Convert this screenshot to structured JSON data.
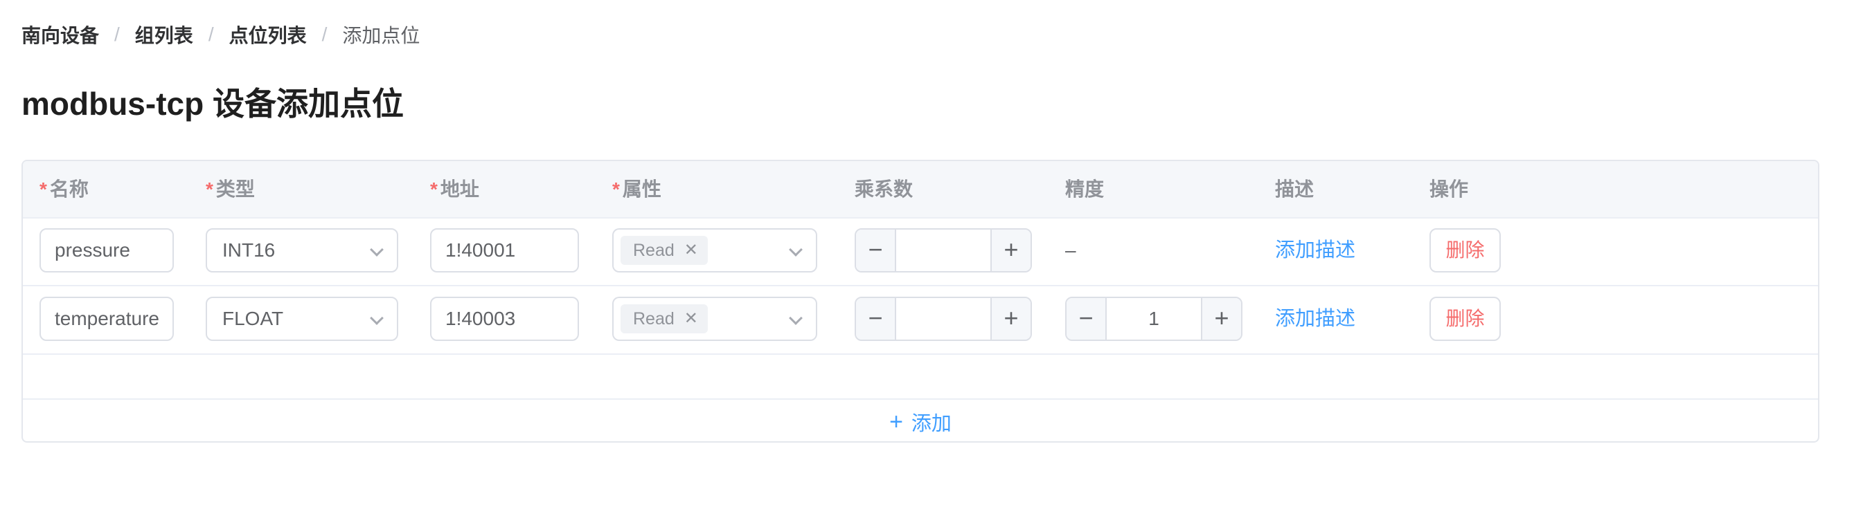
{
  "breadcrumb": {
    "items": [
      "南向设备",
      "组列表",
      "点位列表"
    ],
    "current": "添加点位",
    "separator": "/"
  },
  "page": {
    "title": "modbus-tcp 设备添加点位"
  },
  "table": {
    "required_marker": "*",
    "columns": {
      "name": "名称",
      "type": "类型",
      "address": "地址",
      "attribute": "属性",
      "multiplier": "乘系数",
      "precision": "精度",
      "description": "描述",
      "action": "操作"
    },
    "rows": [
      {
        "name": "pressure",
        "type": "INT16",
        "address": "1!40001",
        "attribute_tag": "Read",
        "multiplier": "",
        "precision": "–",
        "description_link": "添加描述",
        "delete_label": "删除"
      },
      {
        "name": "temperature",
        "type": "FLOAT",
        "address": "1!40003",
        "attribute_tag": "Read",
        "multiplier": "",
        "precision": "1",
        "description_link": "添加描述",
        "delete_label": "删除"
      }
    ],
    "add_label": "添加"
  },
  "icons": {
    "stepper_minus": "minus-icon",
    "stepper_plus": "plus-icon",
    "select_arrow": "chevron-down-icon",
    "tag_close": "close-icon"
  },
  "colors": {
    "required": "#f56c6c",
    "link": "#409eff",
    "danger": "#f56c6c"
  }
}
